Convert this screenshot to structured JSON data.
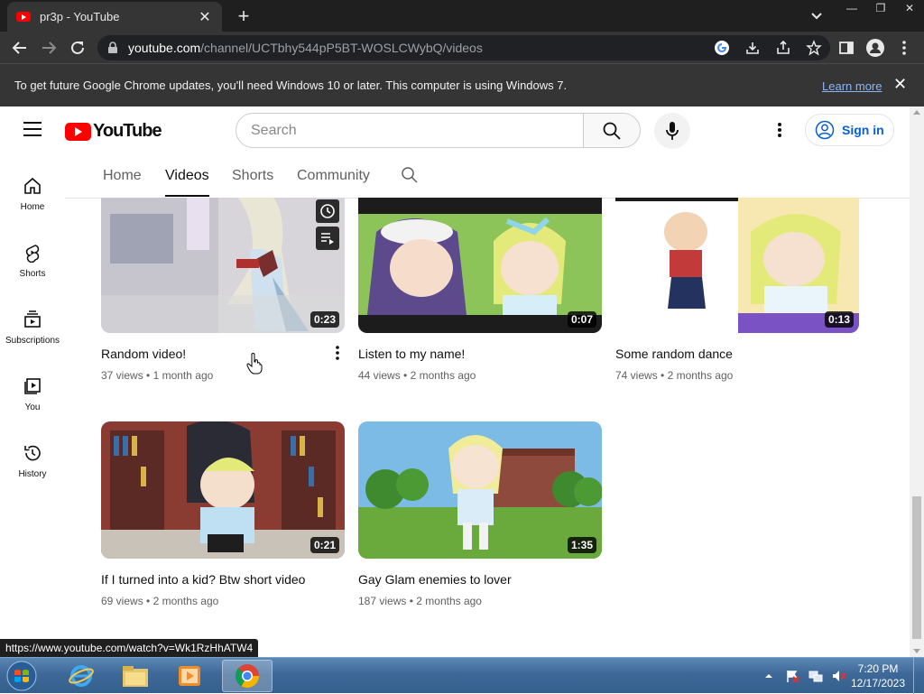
{
  "browser": {
    "tab_title": "pr3p - YouTube",
    "url_host": "youtube.com",
    "url_path": "/channel/UCTbhy544pP5BT-WOSLCWybQ/videos",
    "infobar_message": "To get future Google Chrome updates, you'll need Windows 10 or later. This computer is using Windows 7.",
    "infobar_link": "Learn more",
    "status_url": "https://www.youtube.com/watch?v=Wk1RzHhATW4",
    "window_controls": [
      "—",
      "❐",
      "✕"
    ]
  },
  "youtube": {
    "logo_text": "YouTube",
    "search_placeholder": "Search",
    "signin_label": "Sign in",
    "guide": [
      {
        "label": "Home",
        "icon": "home-icon"
      },
      {
        "label": "Shorts",
        "icon": "shorts-icon"
      },
      {
        "label": "Subscriptions",
        "icon": "subscriptions-icon"
      },
      {
        "label": "You",
        "icon": "you-icon"
      },
      {
        "label": "History",
        "icon": "history-icon"
      }
    ],
    "channel_tabs": [
      {
        "label": "Home",
        "active": false
      },
      {
        "label": "Videos",
        "active": true
      },
      {
        "label": "Shorts",
        "active": false
      },
      {
        "label": "Community",
        "active": false
      }
    ],
    "videos": [
      {
        "title": "Random video!",
        "views": "37 views",
        "age": "1 month ago",
        "duration": "0:23"
      },
      {
        "title": "Listen to my name!",
        "views": "44 views",
        "age": "2 months ago",
        "duration": "0:07"
      },
      {
        "title": "Some random dance",
        "views": "74 views",
        "age": "2 months ago",
        "duration": "0:13"
      },
      {
        "title": "If I turned into a kid? Btw short video",
        "views": "69 views",
        "age": "2 months ago",
        "duration": "0:21"
      },
      {
        "title": "Gay Glam enemies to lover",
        "views": "187 views",
        "age": "2 months ago",
        "duration": "1:35"
      }
    ],
    "meta_separator": "•"
  },
  "taskbar": {
    "time": "7:20 PM",
    "date": "12/17/2023"
  },
  "colors": {
    "brand_red": "#ff0000",
    "link_blue": "#065fd4",
    "chrome_dark": "#353535"
  }
}
